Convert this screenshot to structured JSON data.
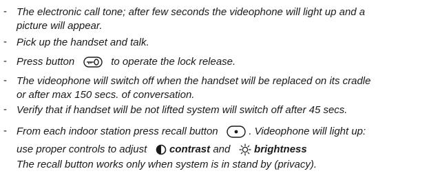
{
  "cut_top_text": "…..",
  "items": [
    {
      "lines": [
        "The electronic call tone; after few seconds the videophone will light up and  a",
        "picture will appear."
      ]
    },
    {
      "lines": [
        "Pick up the handset and talk."
      ]
    },
    {
      "before_icon": "Press button",
      "after_icon": "to operate the lock release."
    },
    {
      "lines": [
        "The videophone will switch off when the handset will be replaced on its cradle",
        "or after max 150 secs. of conversation."
      ]
    },
    {
      "lines": [
        "Verify that if handset will be not lifted system will switch off after 45 secs."
      ]
    },
    {
      "line1_before": "From each indoor station press recall button",
      "line1_after": ". Videophone will light up:",
      "line2_before": "use proper controls to adjust",
      "contrast": "contrast",
      "and": "and",
      "brightness": "brightness",
      "line3": "The recall button works only when system is in stand by (privacy)."
    }
  ],
  "dash": "-",
  "icons": {
    "key": "key-lock-icon",
    "recall": "recall-button-icon",
    "contrast": "contrast-icon",
    "brightness": "brightness-icon"
  }
}
